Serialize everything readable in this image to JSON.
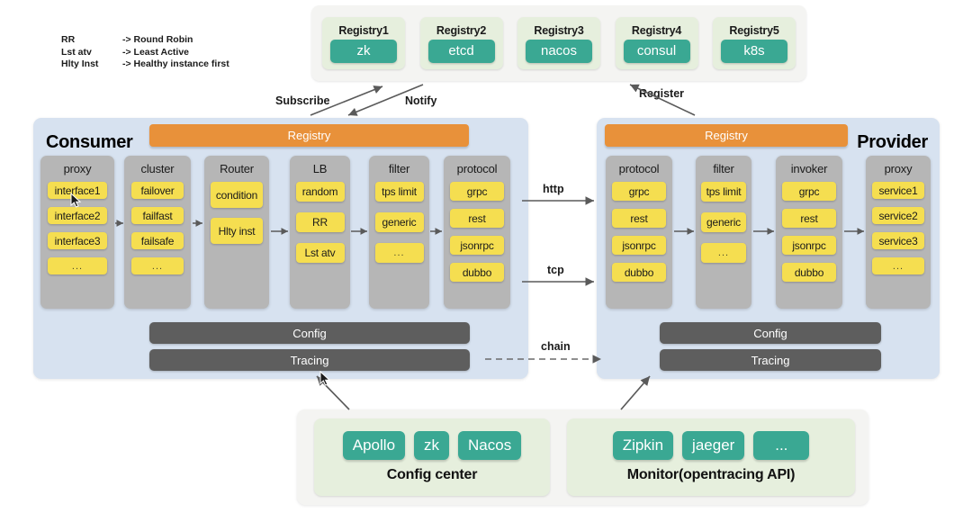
{
  "legend": [
    {
      "key": "RR",
      "value": "-> Round Robin"
    },
    {
      "key": "Lst atv",
      "value": "-> Least Active"
    },
    {
      "key": "Hlty Inst",
      "value": "-> Healthy instance first"
    }
  ],
  "registry_strip": {
    "cards": [
      {
        "title": "Registry1",
        "value": "zk"
      },
      {
        "title": "Registry2",
        "value": "etcd"
      },
      {
        "title": "Registry3",
        "value": "nacos"
      },
      {
        "title": "Registry4",
        "value": "consul"
      },
      {
        "title": "Registry5",
        "value": "k8s"
      }
    ]
  },
  "connectors": {
    "subscribe": "Subscribe",
    "notify": "Notify",
    "register": "Register",
    "http": "http",
    "tcp": "tcp",
    "chain": "chain"
  },
  "consumer": {
    "title": "Consumer",
    "registry_bar": "Registry",
    "columns": [
      {
        "title": "proxy",
        "items": [
          "interface1",
          "interface2",
          "interface3",
          "..."
        ]
      },
      {
        "title": "cluster",
        "items": [
          "failover",
          "failfast",
          "failsafe",
          "..."
        ]
      },
      {
        "title": "Router",
        "items": [
          "condition",
          "Hlty inst"
        ]
      },
      {
        "title": "LB",
        "items": [
          "random",
          "RR",
          "Lst atv"
        ]
      },
      {
        "title": "filter",
        "items": [
          "tps limit",
          "generic",
          "..."
        ]
      },
      {
        "title": "protocol",
        "items": [
          "grpc",
          "rest",
          "jsonrpc",
          "dubbo"
        ]
      }
    ],
    "config_bar": "Config",
    "tracing_bar": "Tracing"
  },
  "provider": {
    "title": "Provider",
    "registry_bar": "Registry",
    "columns": [
      {
        "title": "protocol",
        "items": [
          "grpc",
          "rest",
          "jsonrpc",
          "dubbo"
        ]
      },
      {
        "title": "filter",
        "items": [
          "tps limit",
          "generic",
          "..."
        ]
      },
      {
        "title": "invoker",
        "items": [
          "grpc",
          "rest",
          "jsonrpc",
          "dubbo"
        ]
      },
      {
        "title": "proxy",
        "items": [
          "service1",
          "service2",
          "service3",
          "..."
        ]
      }
    ],
    "config_bar": "Config",
    "tracing_bar": "Tracing"
  },
  "bottom": {
    "config_center": {
      "label": "Config center",
      "pills": [
        "Apollo",
        "zk",
        "Nacos"
      ]
    },
    "monitor": {
      "label": "Monitor(opentracing API)",
      "pills": [
        "Zipkin",
        "jaeger",
        "..."
      ]
    }
  },
  "colors": {
    "teal": "#3aa893",
    "yellow": "#f5de50",
    "orange": "#e8913a",
    "grey_column": "#b6b6b6",
    "panel_blue": "#d7e2f0",
    "dark_bar": "#5e5e5e",
    "card_green": "#e6efdd"
  }
}
